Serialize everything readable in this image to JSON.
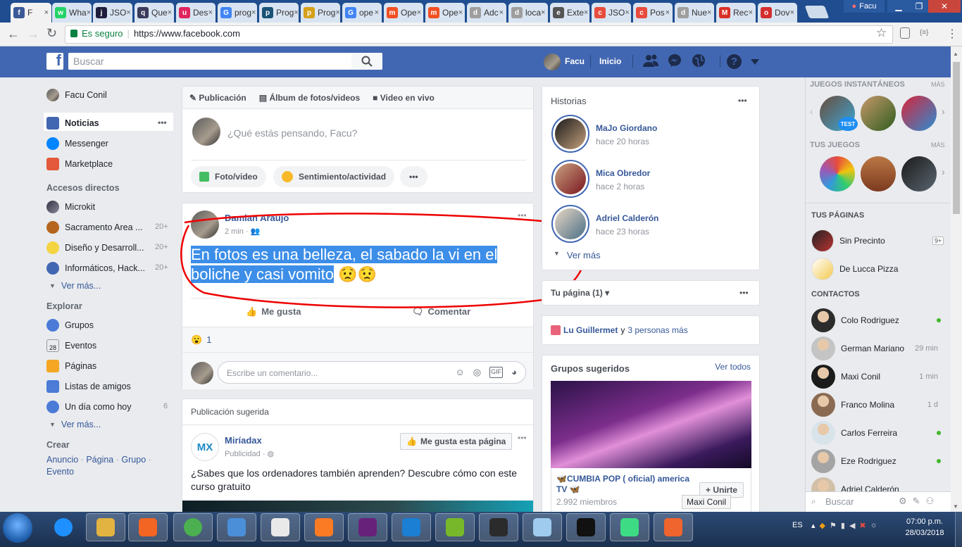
{
  "browser": {
    "tabs": [
      {
        "label": "F",
        "color": "#3b5998",
        "glyph": "f"
      },
      {
        "label": "Wha",
        "color": "#25d366",
        "glyph": "w"
      },
      {
        "label": "JSO",
        "color": "#1e1e3c",
        "glyph": "j"
      },
      {
        "label": "Que",
        "color": "#3b3b5c",
        "glyph": "q"
      },
      {
        "label": "Des",
        "color": "#e0245e",
        "glyph": "u"
      },
      {
        "label": "prog",
        "color": "#4285f4",
        "glyph": "G"
      },
      {
        "label": "Prog",
        "color": "#1a5276",
        "glyph": "p"
      },
      {
        "label": "Prog",
        "color": "#d4a017",
        "glyph": "p"
      },
      {
        "label": "ope",
        "color": "#4285f4",
        "glyph": "G"
      },
      {
        "label": "Ope",
        "color": "#f25022",
        "glyph": "m"
      },
      {
        "label": "Ope",
        "color": "#f25022",
        "glyph": "m"
      },
      {
        "label": "Adc",
        "color": "#9e9e9e",
        "glyph": "d"
      },
      {
        "label": "loca",
        "color": "#9e9e9e",
        "glyph": "d"
      },
      {
        "label": "Exte",
        "color": "#555555",
        "glyph": "e"
      },
      {
        "label": "JSO",
        "color": "#e74c3c",
        "glyph": "c"
      },
      {
        "label": "Pos",
        "color": "#e74c3c",
        "glyph": "c"
      },
      {
        "label": "Nue",
        "color": "#9e9e9e",
        "glyph": "d"
      },
      {
        "label": "Rec",
        "color": "#d93025",
        "glyph": "M"
      },
      {
        "label": "Dov",
        "color": "#d32f2f",
        "glyph": "o"
      }
    ],
    "user": "Facu",
    "secure_label": "Es seguro",
    "url": "https://www.facebook.com",
    "ext_label": "{≡}"
  },
  "fb": {
    "logo": "f",
    "search_placeholder": "Buscar",
    "profile_name": "Facu",
    "home_label": "Inicio",
    "icons": [
      "friends-icon",
      "messenger-icon",
      "globe-icon",
      "help-icon",
      "caret-icon"
    ]
  },
  "left_nav": {
    "user": "Facu Conil",
    "main": [
      {
        "label": "Noticias",
        "color": "#4267b2"
      },
      {
        "label": "Messenger",
        "color": "#0084ff"
      },
      {
        "label": "Marketplace",
        "color": "#e4593b"
      }
    ],
    "shortcuts_title": "Accesos directos",
    "shortcuts": [
      {
        "label": "Microkit",
        "count": ""
      },
      {
        "label": "Sacramento Area ...",
        "count": "20+"
      },
      {
        "label": "Diseño y Desarroll...",
        "count": "20+"
      },
      {
        "label": "Informáticos, Hack...",
        "count": "20+"
      }
    ],
    "see_more": "Ver más...",
    "explore_title": "Explorar",
    "explore": [
      {
        "label": "Grupos",
        "count": "",
        "color": "#4b7bd6"
      },
      {
        "label": "Eventos",
        "count": "",
        "color": "#e9ebee"
      },
      {
        "label": "Páginas",
        "count": "",
        "color": "#f5a623"
      },
      {
        "label": "Listas de amigos",
        "count": "",
        "color": "#4b7bd6"
      },
      {
        "label": "Un día como hoy",
        "count": "6",
        "color": "#4b7bd6"
      }
    ],
    "event_day": "28",
    "create_title": "Crear",
    "create_links": [
      "Anuncio",
      "Página",
      "Grupo",
      "Evento"
    ],
    "sep": "·"
  },
  "composer": {
    "tabs": [
      "Publicación",
      "Álbum de fotos/videos",
      "Video en vivo"
    ],
    "placeholder": "¿Qué estás pensando, Facu?",
    "actions": [
      "Foto/video",
      "Sentimiento/actividad"
    ],
    "more": "•••"
  },
  "post": {
    "author": "Damian Araujo",
    "time": "2 min",
    "text": "En fotos es una belleza, el sabado la vi en el boliche y casi vomito",
    "emoji": "😟😟",
    "like_label": "Me gusta",
    "comment_label": "Comentar",
    "reaction_emoji": "😮",
    "reaction_count": "1",
    "comment_placeholder": "Escribe un comentario...",
    "comment_icons": [
      "emoji-icon",
      "camera-icon",
      "gif-icon",
      "sticker-icon"
    ]
  },
  "suggested": {
    "title": "Publicación sugerida",
    "page": "Miríadax",
    "page_logo": "MX",
    "sponsored": "Publicidad",
    "like_page": "Me gusta esta página",
    "text": "¿Sabes que los ordenadores también aprenden? Descubre cómo con este curso gratuito"
  },
  "stories": {
    "title": "Historias",
    "items": [
      {
        "name": "MaJo Giordano",
        "time": "hace 20 horas"
      },
      {
        "name": "Mica Obredor",
        "time": "hace 2 horas"
      },
      {
        "name": "Adriel Calderón",
        "time": "hace 23 horas"
      }
    ],
    "see_more": "Ver más"
  },
  "your_page": {
    "label": "Tu página (1)"
  },
  "birthday": {
    "name": "Lu Guillermet",
    "connector": "y",
    "others": "3 personas más"
  },
  "groups": {
    "title": "Grupos sugeridos",
    "see_all": "Ver todos",
    "name": "🦋CUMBIA POP ( oficial) america TV 🦋",
    "members": "2.992 miembros",
    "join": "+ Unirte"
  },
  "right_col": {
    "games_title": "JUEGOS INSTANTÁNEOS",
    "more": "MÁS",
    "test_badge": "TEST",
    "your_games_title": "TUS JUEGOS",
    "pages_title": "TUS PÁGINAS",
    "pages": [
      {
        "name": "Sin Precinto",
        "badge": "9+"
      },
      {
        "name": "De Lucca Pizza",
        "badge": ""
      }
    ],
    "contacts_title": "CONTACTOS",
    "contacts": [
      {
        "name": "Colo Rodriguez",
        "time": "",
        "online": true
      },
      {
        "name": "German Mariano",
        "time": "29 min",
        "online": false
      },
      {
        "name": "Maxi Conil",
        "time": "1 min",
        "online": false
      },
      {
        "name": "Franco Molina",
        "time": "1 d",
        "online": false
      },
      {
        "name": "Carlos Ferreira",
        "time": "",
        "online": true
      },
      {
        "name": "Eze Rodriguez",
        "time": "",
        "online": true
      },
      {
        "name": "Adriel Calderón",
        "time": "",
        "online": false
      }
    ],
    "search_placeholder": "Buscar",
    "tooltip": "Maxi Conil"
  },
  "taskbar": {
    "lang": "ES",
    "time": "07:00 p.m.",
    "date": "28/03/2018",
    "apps": [
      {
        "name": "ie-icon",
        "color": "#1e90ff"
      },
      {
        "name": "explorer-icon",
        "color": "#e3b341"
      },
      {
        "name": "media-player-icon",
        "color": "#f26522"
      },
      {
        "name": "chrome-icon",
        "color": "#4caf50"
      },
      {
        "name": "virtualbox-icon",
        "color": "#4a8fd8"
      },
      {
        "name": "brackets-icon",
        "color": "#e9e9e9"
      },
      {
        "name": "xampp-icon",
        "color": "#fb7a24"
      },
      {
        "name": "visual-studio-icon",
        "color": "#68217a"
      },
      {
        "name": "vscode-icon",
        "color": "#1b7fd4"
      },
      {
        "name": "utorrent-icon",
        "color": "#76b82a"
      },
      {
        "name": "terminal-icon",
        "color": "#2b2b2b"
      },
      {
        "name": "notepad-icon",
        "color": "#9ecbee"
      },
      {
        "name": "cmd-icon",
        "color": "#111111"
      },
      {
        "name": "android-studio-icon",
        "color": "#3ddc84"
      },
      {
        "name": "tool-icon",
        "color": "#f0642d"
      }
    ]
  }
}
